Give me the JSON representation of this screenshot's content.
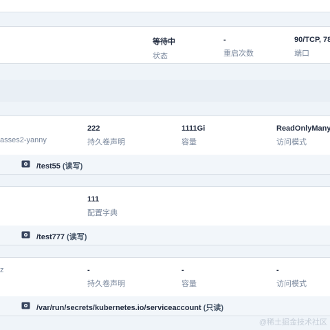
{
  "container": {
    "status_value": "等待中",
    "status_label": "状态",
    "restarts_value": "-",
    "restarts_label": "重启次数",
    "ports_value": "90/TCP, 78/",
    "ports_label": "端口"
  },
  "volumes": [
    {
      "name": "asses2-yanny",
      "type_value": "222",
      "type_label": "持久卷声明",
      "capacity_value": "1111Gi",
      "capacity_label": "容量",
      "access_value": "ReadOnlyMany",
      "access_label": "访问模式",
      "mount_path": "/test55",
      "mount_mode": "(读写)"
    },
    {
      "type_value": "111",
      "type_label": "配置字典",
      "mount_path": "/test777",
      "mount_mode": "(读写)"
    },
    {
      "name": "z",
      "type_value": "-",
      "type_label": "持久卷声明",
      "capacity_value": "-",
      "capacity_label": "容量",
      "access_value": "-",
      "access_label": "访问模式",
      "mount_path": "/var/run/secrets/kubernetes.io/serviceaccount",
      "mount_mode": "(只读)"
    }
  ],
  "watermark": "@稀土掘金技术社区",
  "icons": {
    "mount": "hard-disk-icon"
  }
}
